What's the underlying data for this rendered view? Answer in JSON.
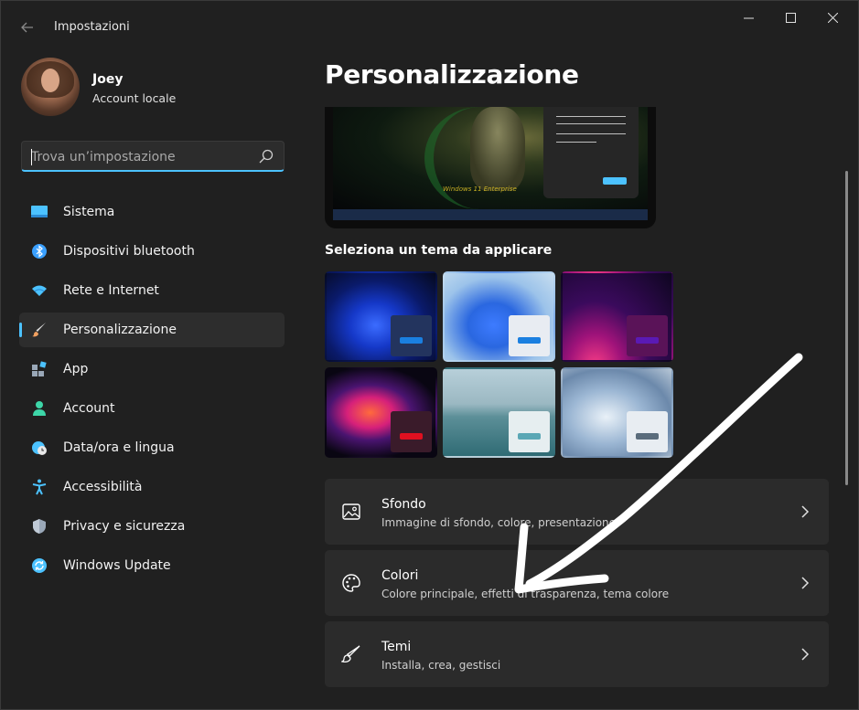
{
  "window": {
    "title": "Impostazioni"
  },
  "user": {
    "name": "Joey",
    "account_type": "Account locale"
  },
  "search": {
    "placeholder": "Trova un’impostazione"
  },
  "sidebar": {
    "items": [
      {
        "label": "Sistema",
        "icon": "system-icon",
        "color": "#4cc2ff"
      },
      {
        "label": "Dispositivi bluetooth",
        "icon": "bluetooth-icon",
        "color": "#3aa0ff"
      },
      {
        "label": "Rete e Internet",
        "icon": "wifi-icon",
        "color": "#4cc2ff"
      },
      {
        "label": "Personalizzazione",
        "icon": "brush-icon",
        "color": "#f0a060",
        "active": true
      },
      {
        "label": "App",
        "icon": "apps-icon",
        "color": "#9aa8b8"
      },
      {
        "label": "Account",
        "icon": "person-icon",
        "color": "#3dd6a8"
      },
      {
        "label": "Data/ora e lingua",
        "icon": "globe-clock-icon",
        "color": "#4cc2ff"
      },
      {
        "label": "Accessibilità",
        "icon": "accessibility-icon",
        "color": "#4cc2ff"
      },
      {
        "label": "Privacy e sicurezza",
        "icon": "shield-icon",
        "color": "#9aa8b8"
      },
      {
        "label": "Windows Update",
        "icon": "update-icon",
        "color": "#4cc2ff"
      }
    ]
  },
  "main": {
    "page_title": "Personalizzazione",
    "preview_watermark": "Windows 11 Enterprise",
    "themes_heading": "Seleziona un tema da applicare",
    "themes": [
      {
        "name": "theme-windows-dark",
        "swatch": "#23345e",
        "bar": "#1a7fe0"
      },
      {
        "name": "theme-windows-light",
        "swatch": "#e8ecf2",
        "bar": "#1a7fe0"
      },
      {
        "name": "theme-glow",
        "swatch": "#5a1358",
        "bar": "#5a1ab4"
      },
      {
        "name": "theme-captured-motion",
        "swatch": "#3a1b2a",
        "bar": "#e01020"
      },
      {
        "name": "theme-sunrise",
        "swatch": "#e6eef0",
        "bar": "#5aa7b5"
      },
      {
        "name": "theme-flow",
        "swatch": "#e8edf2",
        "bar": "#5a6c7c"
      }
    ],
    "settings": [
      {
        "title": "Sfondo",
        "description": "Immagine di sfondo, colore, presentazione",
        "icon": "image-icon"
      },
      {
        "title": "Colori",
        "description": "Colore principale, effetti di trasparenza, tema colore",
        "icon": "palette-icon"
      },
      {
        "title": "Temi",
        "description": "Installa, crea, gestisci",
        "icon": "brush-icon"
      }
    ]
  },
  "colors": {
    "accent": "#4cc2ff",
    "window_bg": "#202020",
    "card_bg": "#2b2b2b"
  }
}
